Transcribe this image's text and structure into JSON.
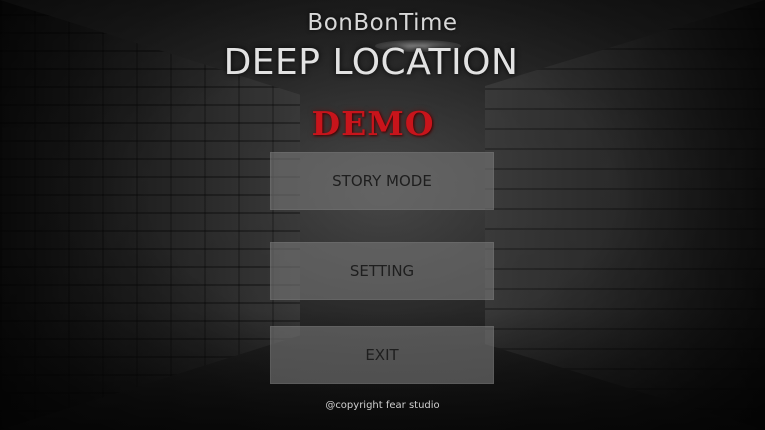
{
  "studio_name": "BonBonTime",
  "game_title": "DEEP LOCATION",
  "edition_badge": "DEMO",
  "menu": {
    "story_mode_label": "STORY MODE",
    "setting_label": "SETTING",
    "exit_label": "EXIT"
  },
  "footer": {
    "copyright": "@copyright fear studio"
  },
  "colors": {
    "demo_red": "#c8141b",
    "button_bg": "#767676"
  }
}
